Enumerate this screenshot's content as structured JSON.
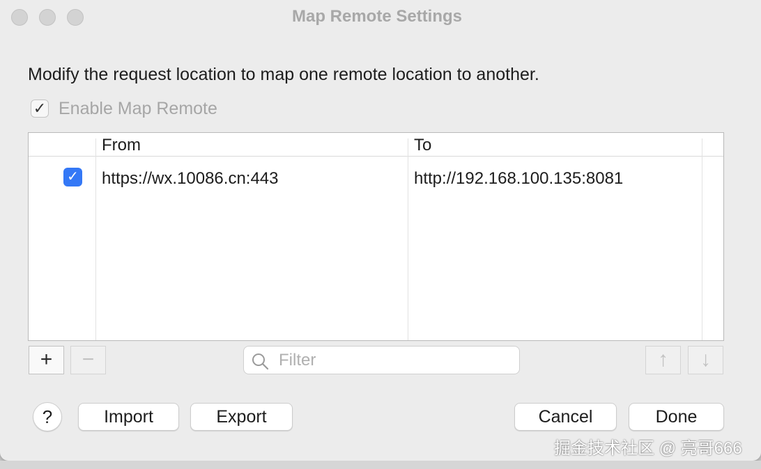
{
  "window": {
    "title": "Map Remote Settings"
  },
  "description": "Modify the request location to map one remote location to another.",
  "enable_map_remote": {
    "label": "Enable Map Remote",
    "checked": true
  },
  "table": {
    "columns": [
      "From",
      "To"
    ],
    "rows": [
      {
        "enabled": true,
        "from": "https://wx.10086.cn:443",
        "to": "http://192.168.100.135:8081"
      }
    ]
  },
  "toolbar": {
    "add_label": "+",
    "remove_label": "−",
    "filter_placeholder": "Filter",
    "move_up_label": "↑",
    "move_down_label": "↓"
  },
  "footer": {
    "help_label": "?",
    "import_label": "Import",
    "export_label": "Export",
    "cancel_label": "Cancel",
    "done_label": "Done"
  },
  "watermark": "掘金技术社区 @ 亮哥666",
  "colors": {
    "accent": "#3478f6",
    "window_bg": "#ececec",
    "title_text": "#a8a8a8"
  }
}
